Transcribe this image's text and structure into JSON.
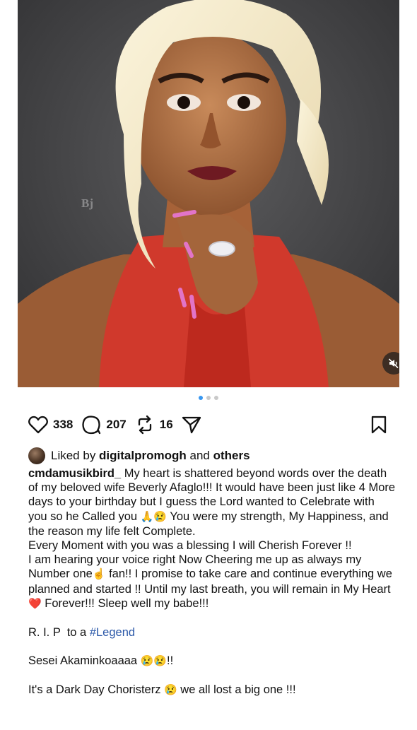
{
  "post": {
    "media": {
      "watermark": "Bj",
      "mute_icon": "speaker-muted-icon",
      "carousel_count": 3,
      "carousel_active": 1
    },
    "actions": {
      "likes": "338",
      "comments": "207",
      "reposts": "16",
      "icons": {
        "like": "heart-icon",
        "comment": "comment-bubble-icon",
        "repost": "repost-icon",
        "share": "paper-plane-icon",
        "save": "bookmark-icon"
      }
    },
    "liked_by": {
      "prefix": "Liked by ",
      "user": "digitalpromogh",
      "connector": " and ",
      "others": "others"
    },
    "caption": {
      "username": "cmdamusikbird_",
      "line1": " My heart is shattered beyond words over the death of my beloved wife Beverly Afaglo!!! It would have been just like 4 More days to your birthday but I guess the Lord wanted to Celebrate with you so he Called you ",
      "emoji_pray": "🙏",
      "emoji_cry": "😢",
      "line1_end": " You were my strength, My Happiness, and the reason my life felt Complete.",
      "line2": "Every Moment with you was a blessing I will Cherish Forever !!",
      "line3_a": "I am hearing your voice right Now Cheering me up as always my Number one",
      "emoji_point": "☝",
      "line3_b": " fan!! I promise to take care and continue everything we planned and started !! Until my last breath, you will remain in My Heart ",
      "emoji_heart": "❤️",
      "line3_c": " Forever!!! Sleep well my babe!!!",
      "rip_prefix": "R. I. P  to a ",
      "hashtag": "#Legend",
      "sesei": "Sesei Akaminkoaaaa ",
      "sesei_emoji": "😢😢",
      "sesei_end": "!!",
      "dark_day": "It's a Dark Day Choristerz ",
      "dark_emoji": "😢",
      "dark_end": " we all lost a big one !!!"
    }
  }
}
